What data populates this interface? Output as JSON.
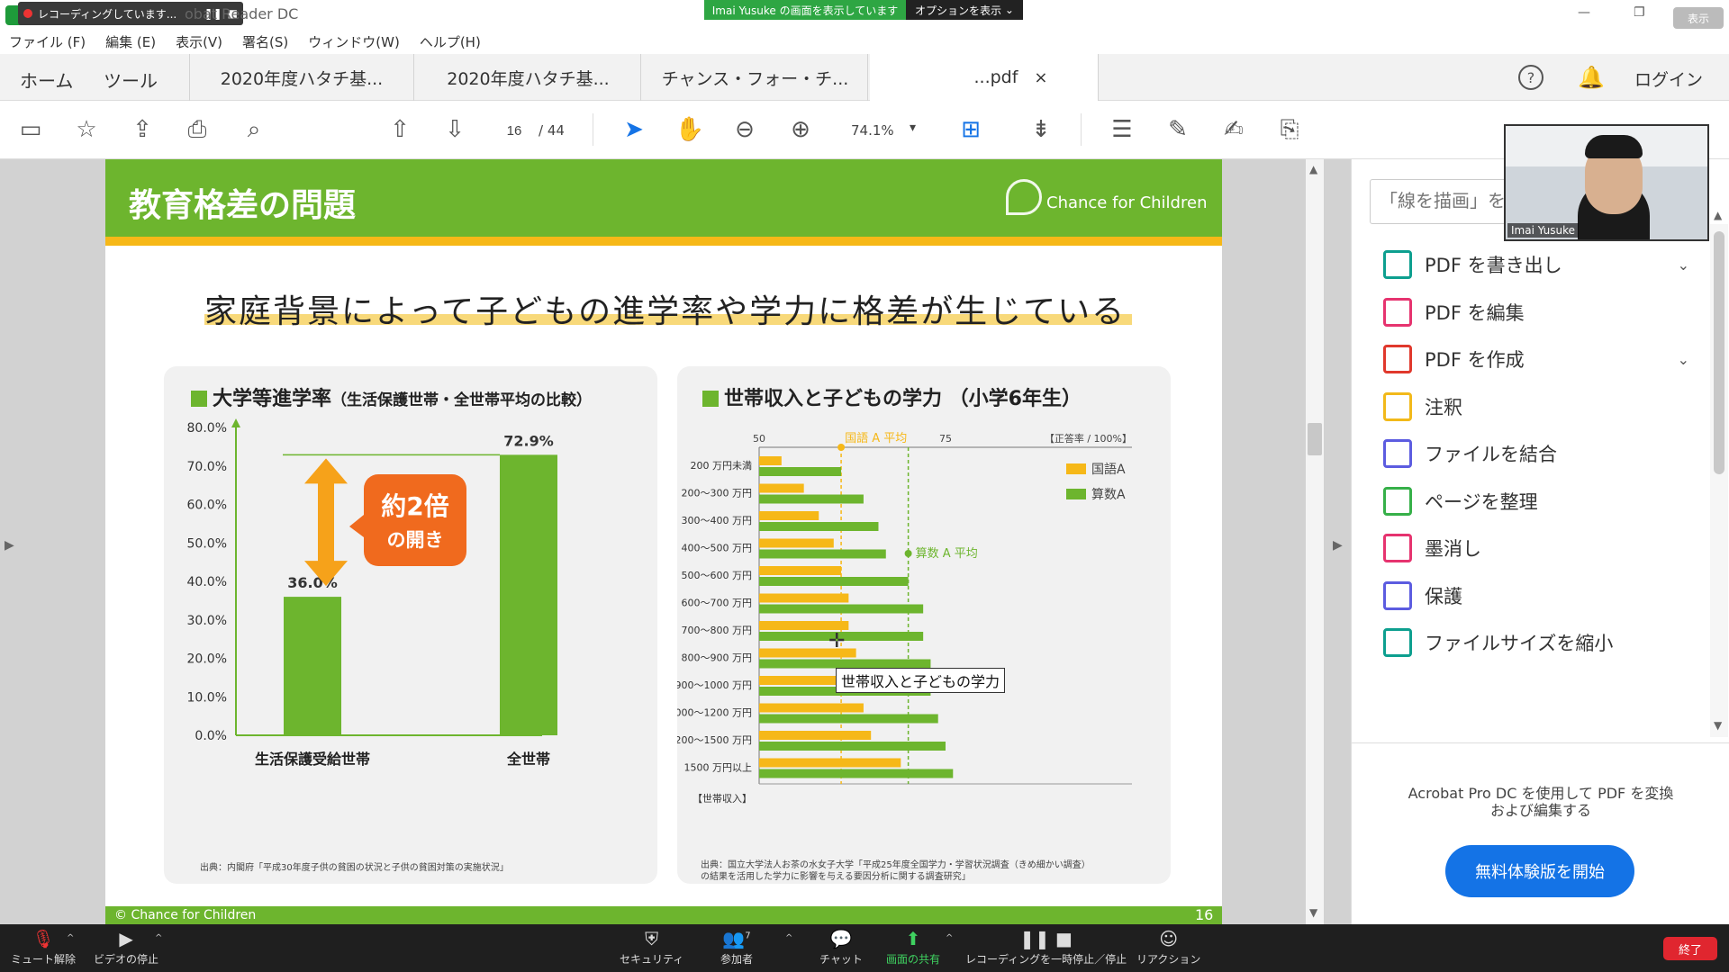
{
  "window": {
    "title": "MC_...—Adobe Acrobat Reader DC",
    "title_visible": "obat Reader DC",
    "recording": "レコーディングしています...",
    "share_banner": "Imai Yusuke の画面を表示しています",
    "share_options": "オプションを表示",
    "view_btn": "表示"
  },
  "menu": [
    "ファイル (F)",
    "編集 (E)",
    "表示(V)",
    "署名(S)",
    "ウィンドウ(W)",
    "ヘルプ(H)"
  ],
  "tabs": {
    "home": "ホーム",
    "tools": "ツール",
    "docs": [
      "2020年度ハタチ基...",
      "2020年度ハタチ基...",
      "チャンス・フォー・チ...",
      "...pdf"
    ],
    "close": "×",
    "help": "?",
    "login": "ログイン"
  },
  "toolbar": {
    "page_current": "16",
    "page_total": "/ 44",
    "zoom": "74.1%"
  },
  "slide": {
    "title": "教育格差の問題",
    "brand": "Chance for Children",
    "headline": "家庭背景によって子どもの進学率や学力に格差が生じている",
    "left_title": "大学等進学率",
    "left_subtitle": "（生活保護世帯・全世帯平均の比較）",
    "callout_1": "約2倍",
    "callout_2": "の開き",
    "left_source": "出典：内閣府「平成30年度子供の貧困の状況と子供の貧困対策の実施状況」",
    "right_title": "世帯収入と子どもの学力 （小学6年生）",
    "right_source_1": "出典：国立大学法人お茶の水女子大学「平成25年度全国学力・学習状況調査（きめ細かい調査）",
    "right_source_2": "の結果を活用した学力に影響を与える要因分析に関する調査研究」",
    "footer": "© Chance for Children",
    "page": "16",
    "tooltip": "世帯収入と子どもの学力"
  },
  "chart_data": [
    {
      "type": "bar",
      "title": "大学等進学率",
      "categories": [
        "生活保護受給世帯",
        "全世帯"
      ],
      "values": [
        36.0,
        72.9
      ],
      "data_labels": [
        "36.0%",
        "72.9%"
      ],
      "ylim": [
        0,
        80
      ],
      "yticks": [
        "0.0%",
        "10.0%",
        "20.0%",
        "30.0%",
        "40.0%",
        "50.0%",
        "60.0%",
        "70.0%",
        "80.0%"
      ],
      "color": "#6db52e"
    },
    {
      "type": "bar",
      "orientation": "horizontal",
      "title": "世帯収入と子どもの学力 （小学6年生）",
      "categories": [
        "200 万円未満",
        "200～300 万円",
        "300～400 万円",
        "400～500 万円",
        "500～600 万円",
        "600～700 万円",
        "700～800 万円",
        "800～900 万円",
        "900～1000 万円",
        "1000～1200 万円",
        "1200～1500 万円",
        "1500 万円以上"
      ],
      "category_axis_label": "【世帯収入】",
      "value_axis_label": "【正答率 / 100%】",
      "xlim": [
        50,
        100
      ],
      "xticks": [
        "50",
        "75"
      ],
      "series": [
        {
          "name": "国語A",
          "color": "#f6b818",
          "values": [
            53,
            56,
            58,
            60,
            61,
            62,
            62,
            63,
            64,
            64,
            65,
            69
          ]
        },
        {
          "name": "算数A",
          "color": "#6db52e",
          "values": [
            61,
            64,
            66,
            67,
            70,
            72,
            72,
            73,
            73,
            74,
            75,
            76
          ]
        }
      ],
      "ref_lines": [
        {
          "label": "国語 A 平均",
          "value": 61
        },
        {
          "label": "算数 A 平均",
          "value": 70
        }
      ]
    }
  ],
  "rightpane": {
    "search_placeholder": "「線を描画」を検",
    "items": [
      {
        "label": "PDF を書き出し",
        "icon": "export-pdf-icon",
        "color": "#0d9f8f",
        "chev": "⌄"
      },
      {
        "label": "PDF を編集",
        "icon": "edit-pdf-icon",
        "color": "#e6336f",
        "chev": ""
      },
      {
        "label": "PDF を作成",
        "icon": "create-pdf-icon",
        "color": "#e0382c",
        "chev": "⌄"
      },
      {
        "label": "注釈",
        "icon": "comment-icon",
        "color": "#f2b91a",
        "chev": ""
      },
      {
        "label": "ファイルを結合",
        "icon": "combine-icon",
        "color": "#5c5ce0",
        "chev": ""
      },
      {
        "label": "ページを整理",
        "icon": "organize-icon",
        "color": "#36b049",
        "chev": ""
      },
      {
        "label": "墨消し",
        "icon": "redact-icon",
        "color": "#e6336f",
        "chev": ""
      },
      {
        "label": "保護",
        "icon": "protect-icon",
        "color": "#5c5ce0",
        "chev": ""
      },
      {
        "label": "ファイルサイズを縮小",
        "icon": "compress-icon",
        "color": "#0d9f8f",
        "chev": ""
      }
    ],
    "promo": "Acrobat Pro DC を使用して PDF を変換および編集する",
    "trial": "無料体験版を開始"
  },
  "webcam": {
    "name": "Imai Yusuke"
  },
  "zoombar": {
    "left": [
      {
        "label": "ミュート解除",
        "icon": "mic-off-icon"
      },
      {
        "label": "ビデオの停止",
        "icon": "video-icon"
      }
    ],
    "center": [
      {
        "label": "セキュリティ",
        "icon": "security-icon"
      },
      {
        "label": "参加者",
        "icon": "participants-icon",
        "count": "7"
      },
      {
        "label": "チャット",
        "icon": "chat-icon"
      },
      {
        "label": "画面の共有",
        "icon": "share-screen-icon"
      },
      {
        "label": "レコーディングを一時停止／停止",
        "icon": "recording-icon"
      },
      {
        "label": "リアクション",
        "icon": "reaction-icon"
      }
    ],
    "end": "終了"
  }
}
